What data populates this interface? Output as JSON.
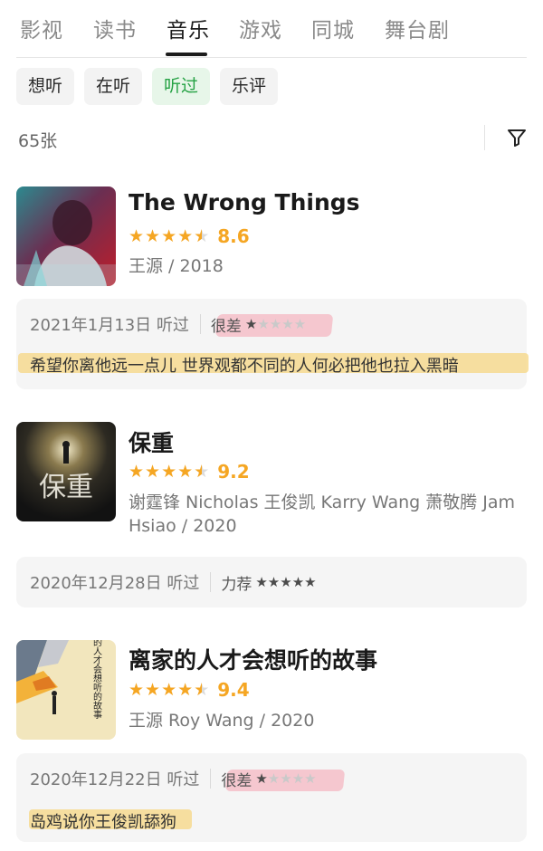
{
  "tabs": [
    {
      "label": "影视",
      "active": false
    },
    {
      "label": "读书",
      "active": false
    },
    {
      "label": "音乐",
      "active": true
    },
    {
      "label": "游戏",
      "active": false
    },
    {
      "label": "同城",
      "active": false
    },
    {
      "label": "舞台剧",
      "active": false
    }
  ],
  "filters": [
    {
      "label": "想听",
      "active": false
    },
    {
      "label": "在听",
      "active": false
    },
    {
      "label": "听过",
      "active": true
    },
    {
      "label": "乐评",
      "active": false
    }
  ],
  "count_label": "65张",
  "filter_icon": "funnel-icon",
  "colors": {
    "accent_green": "#25a244",
    "chip_active_bg": "#e7f6e9",
    "star_orange": "#f5a623",
    "highlight_pink": "#f4a0af",
    "highlight_yellow": "#f6d682"
  },
  "items": [
    {
      "title": "The Wrong Things",
      "rating_stars": 4.5,
      "score": "8.6",
      "meta": "王源 / 2018",
      "review": {
        "date": "2021年1月13日 听过",
        "level": "很差",
        "user_stars": 1,
        "text": "希望你离他远一点儿 世界观都不同的人何必把他也拉入黑暗"
      }
    },
    {
      "title": "保重",
      "rating_stars": 4.5,
      "score": "9.2",
      "meta": "谢霆锋 Nicholas 王俊凯 Karry Wang 萧敬腾 Jam Hsiao / 2020",
      "cover_text": "保重",
      "review": {
        "date": "2020年12月28日 听过",
        "level": "力荐",
        "user_stars": 5,
        "text": ""
      }
    },
    {
      "title": "离家的人才会想听的故事",
      "rating_stars": 4.5,
      "score": "9.4",
      "meta": "王源 Roy Wang / 2020",
      "cover_text": "离家的人才会想听的故事",
      "review": {
        "date": "2020年12月22日 听过",
        "level": "很差",
        "user_stars": 1,
        "text": "岛鸡说你王俊凯舔狗"
      }
    }
  ]
}
